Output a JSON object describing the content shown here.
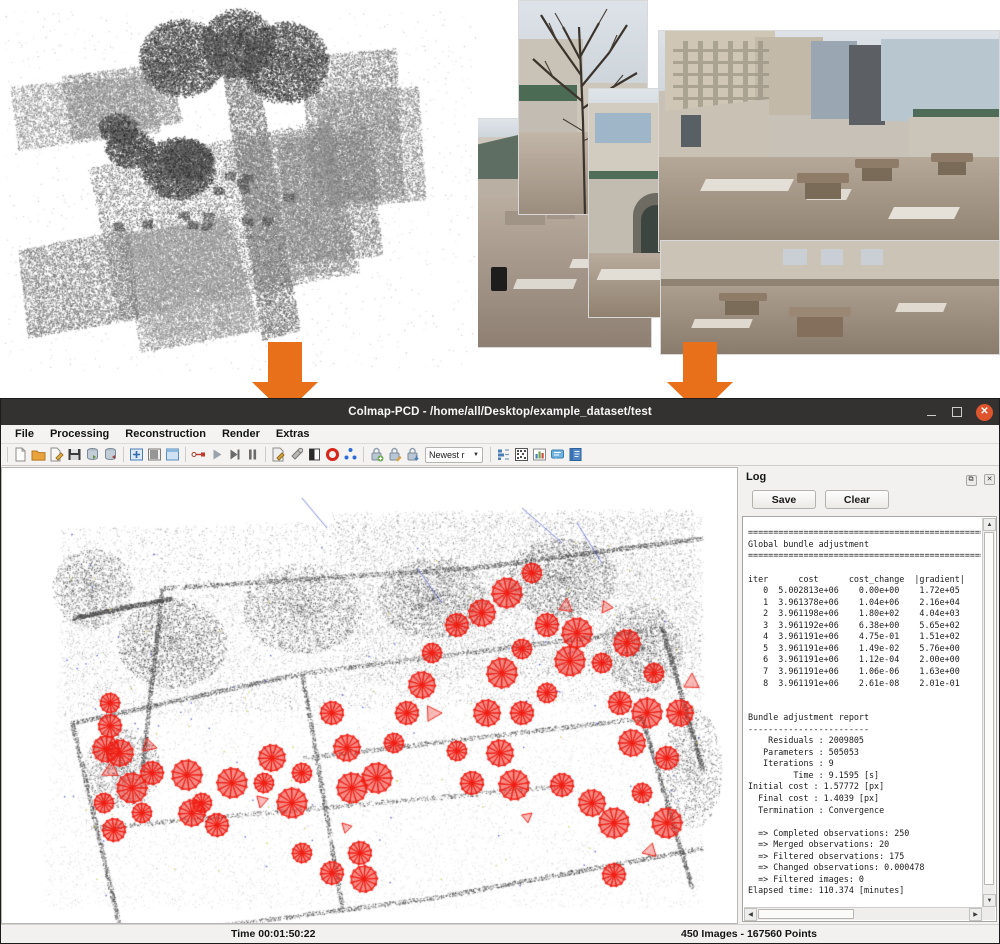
{
  "figure": {
    "left_panel": {
      "name": "lidar-point-cloud-render",
      "caption": ""
    },
    "right_panel": {
      "name": "photo-collage",
      "caption": ""
    },
    "arrow_color": "#e8701a",
    "arrows": [
      {
        "name": "arrow-pointcloud-to-app"
      },
      {
        "name": "arrow-photos-to-app"
      }
    ]
  },
  "window": {
    "title": "Colmap-PCD - /home/all/Desktop/example_dataset/test",
    "controls": {
      "minimize": "–",
      "maximize": "□",
      "close": "✕"
    },
    "accent_close": "#e0542d",
    "titlebar_bg": "#333230"
  },
  "menubar": {
    "items": [
      {
        "label": "File"
      },
      {
        "label": "Processing"
      },
      {
        "label": "Reconstruction"
      },
      {
        "label": "Render"
      },
      {
        "label": "Extras"
      }
    ]
  },
  "toolbar": {
    "combo_value": "Newest r",
    "combo_caret": "▼",
    "icons": [
      {
        "name": "new-project-icon",
        "glyph": "page",
        "color": "#fdfdfd"
      },
      {
        "name": "open-project-icon",
        "glyph": "folder",
        "color": "#e8a33d"
      },
      {
        "name": "edit-project-icon",
        "glyph": "page-pencil",
        "color": "#f2f2f2"
      },
      {
        "name": "save-project-icon",
        "glyph": "floppy",
        "color": "#3b3b3b"
      },
      {
        "name": "import-model-icon",
        "glyph": "db-in",
        "color": "#8d9aa6"
      },
      {
        "name": "export-model-icon",
        "glyph": "db-out",
        "color": "#8d9aa6"
      },
      {
        "name": "feature-extraction-icon",
        "glyph": "grid-plus",
        "color": "#4a7fb5"
      },
      {
        "name": "feature-matching-icon",
        "glyph": "bars",
        "color": "#5c5c5c"
      },
      {
        "name": "window-icon",
        "glyph": "window",
        "color": "#7ca6cf"
      },
      {
        "name": "start-reconstruction-icon",
        "glyph": "dot-line",
        "color": "#c0392b"
      },
      {
        "name": "play-icon",
        "glyph": "play",
        "color": "#9aa3ab"
      },
      {
        "name": "step-icon",
        "glyph": "step",
        "color": "#6b6b6b"
      },
      {
        "name": "pause-icon",
        "glyph": "pause",
        "color": "#6b6b6b"
      },
      {
        "name": "bundle-adjustment-icon",
        "glyph": "page-pencil2",
        "color": "#e6e6e6"
      },
      {
        "name": "dense-recon-icon",
        "glyph": "wrench",
        "color": "#8a8a8a"
      },
      {
        "name": "render-options-icon",
        "glyph": "halfblock",
        "color": "#2b2b2b"
      },
      {
        "name": "reset-view-icon",
        "glyph": "circle-red",
        "color": "#d8261a"
      },
      {
        "name": "points-icon",
        "glyph": "dots-blue",
        "color": "#2f6bd6"
      },
      {
        "name": "lock-add-icon",
        "glyph": "lock-plus",
        "color": "#9eaebd"
      },
      {
        "name": "lock-edit-icon",
        "glyph": "lock-edit",
        "color": "#9eaebd"
      },
      {
        "name": "lock-down-icon",
        "glyph": "lock-down",
        "color": "#9eaebd"
      },
      {
        "name": "model-stats-icon",
        "glyph": "chart-list",
        "color": "#4a7fb5"
      },
      {
        "name": "match-matrix-icon",
        "glyph": "qr",
        "color": "#4c4c4c"
      },
      {
        "name": "statistics-icon",
        "glyph": "bar-chart",
        "color": "#d14b3c"
      },
      {
        "name": "log-icon",
        "glyph": "note",
        "color": "#4a9ed6"
      },
      {
        "name": "database-icon",
        "glyph": "book",
        "color": "#3a6fb0"
      }
    ]
  },
  "viewport": {
    "name": "3d-model-viewport",
    "point_color_dark": "#444444",
    "camera_frustum_color": "#f01e14"
  },
  "log_panel": {
    "title": "Log",
    "float_button": "⧉",
    "close_button": "✕",
    "save_label": "Save",
    "clear_label": "Clear",
    "text": "======================================================\nGlobal bundle adjustment\n======================================================\n\niter      cost      cost_change  |gradient|\n   0  5.002813e+06    0.00e+00    1.72e+05\n   1  3.961378e+06    1.04e+06    2.16e+04\n   2  3.961198e+06    1.80e+02    4.04e+03\n   3  3.961192e+06    6.38e+00    5.65e+02\n   4  3.961191e+06    4.75e-01    1.51e+02\n   5  3.961191e+06    1.49e-02    5.76e+00\n   6  3.961191e+06    1.12e-04    2.00e+00\n   7  3.961191e+06    1.06e-06    1.63e+00\n   8  3.961191e+06    2.61e-08    2.01e-01\n\n\nBundle adjustment report\n------------------------\n    Residuals : 2009805\n   Parameters : 505053\n   Iterations : 9\n         Time : 9.1595 [s]\nInitial cost : 1.57772 [px]\n  Final cost : 1.4039 [px]\n  Termination : Convergence\n\n  => Completed observations: 250\n  => Merged observations: 20\n  => Filtered observations: 175\n  => Changed observations: 0.000478\n  => Filtered images: 0\nElapsed time: 110.374 [minutes]",
    "scroll": {
      "up": "▲",
      "down": "▼",
      "left": "◀",
      "right": "▶"
    }
  },
  "statusbar": {
    "time_label": "Time 00:01:50:22",
    "stats_label": "450 Images - 167560 Points"
  }
}
